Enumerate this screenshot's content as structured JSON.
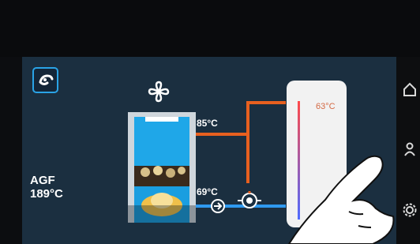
{
  "icons": {
    "home": "home-icon",
    "fan": "fan-icon",
    "pump": "pump-icon",
    "valve": "valve-icon",
    "boiler": "boiler-icon",
    "tank": "storage-tank-icon"
  },
  "left_panel": {
    "label": "AGF",
    "temperature": "189°C"
  },
  "boiler": {
    "flow_temperature": "85°C",
    "return_temperature": "69°C"
  },
  "tank": {
    "temperature": "63°C"
  },
  "colors": {
    "screen_bg": "#1b2f40",
    "accent_blue": "#2aa3e6",
    "flow_orange": "#e8601f",
    "return_blue": "#2f9af0"
  }
}
